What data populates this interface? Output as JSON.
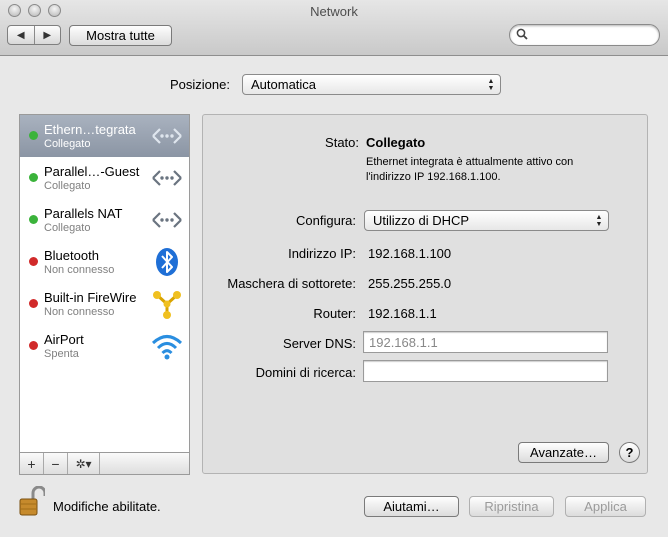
{
  "window": {
    "title": "Network"
  },
  "toolbar": {
    "back_label": "◀",
    "forward_label": "▶",
    "show_all_label": "Mostra tutte",
    "search_placeholder": ""
  },
  "location": {
    "label": "Posizione:",
    "value": "Automatica"
  },
  "services": [
    {
      "name": "Ethern…tegrata",
      "status": "Collegato",
      "state_color": "#3bb33b",
      "icon": "ethernet-arrows-icon",
      "selected": true
    },
    {
      "name": "Parallel…-Guest",
      "status": "Collegato",
      "state_color": "#3bb33b",
      "icon": "ethernet-arrows-icon"
    },
    {
      "name": "Parallels NAT",
      "status": "Collegato",
      "state_color": "#3bb33b",
      "icon": "ethernet-arrows-icon"
    },
    {
      "name": "Bluetooth",
      "status": "Non connesso",
      "state_color": "#d12a2a",
      "icon": "bluetooth-icon"
    },
    {
      "name": "Built-in FireWire",
      "status": "Non connesso",
      "state_color": "#d12a2a",
      "icon": "firewire-icon"
    },
    {
      "name": "AirPort",
      "status": "Spenta",
      "state_color": "#d12a2a",
      "icon": "wifi-icon"
    }
  ],
  "sidebar_controls": {
    "add": "+",
    "remove": "−",
    "gear": "✲▾"
  },
  "detail": {
    "status_label": "Stato:",
    "status_value": "Collegato",
    "status_desc_line1": "Ethernet integrata è attualmente attivo con",
    "status_desc_line2": "l'indirizzo IP 192.168.1.100.",
    "configure_label": "Configura:",
    "configure_value": "Utilizzo di DHCP",
    "ip_label": "Indirizzo IP:",
    "ip_value": "192.168.1.100",
    "mask_label": "Maschera di sottorete:",
    "mask_value": "255.255.255.0",
    "router_label": "Router:",
    "router_value": "192.168.1.1",
    "dns_label": "Server DNS:",
    "dns_value": "192.168.1.1",
    "search_domains_label": "Domini di ricerca:",
    "search_domains_value": "",
    "advanced_label": "Avanzate…",
    "help_label": "?"
  },
  "footer": {
    "lock_text": "Modifiche abilitate.",
    "assist_label": "Aiutami…",
    "revert_label": "Ripristina",
    "apply_label": "Applica"
  }
}
